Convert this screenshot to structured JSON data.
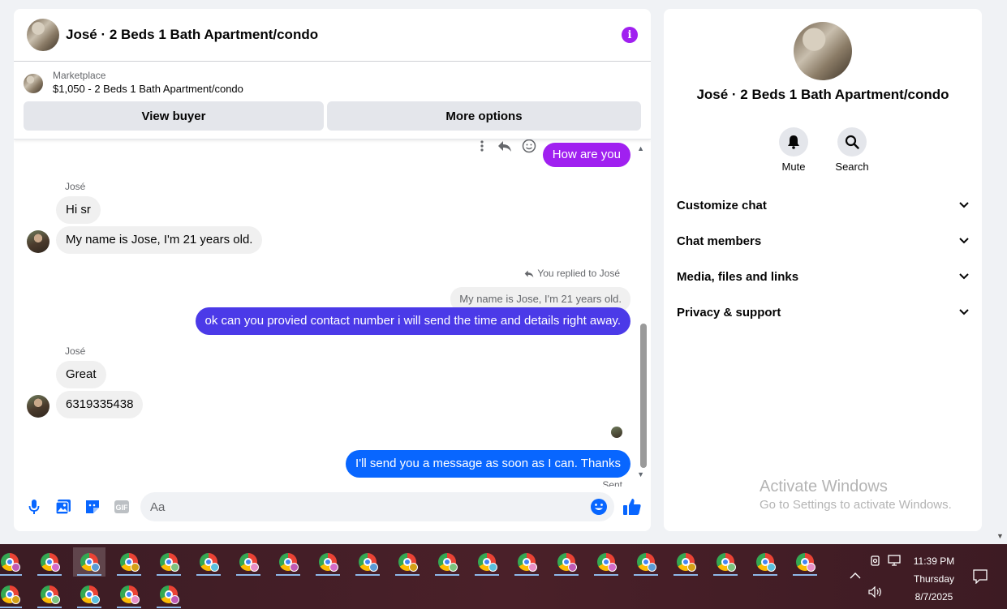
{
  "chat": {
    "title": "José · 2 Beds 1 Bath Apartment/condo",
    "marketplace_label": "Marketplace",
    "listing": "$1,050 - 2 Beds 1 Bath Apartment/condo",
    "view_buyer": "View buyer",
    "more_options": "More options",
    "input_placeholder": "Aa"
  },
  "messages": {
    "m1_out": "How are you",
    "sender1": "José",
    "m2_in": "Hi sr",
    "m3_in": "My name is Jose, I'm 21 years old.",
    "reply_meta": "You replied to José",
    "quoted": "My name is Jose, I'm 21 years old.",
    "m4_out": "ok can you provied contact number i will send the time and details right away.",
    "sender2": "José",
    "m5_in": "Great",
    "m6_in": "6319335438",
    "m7_out": "I'll send you a message as soon as I can. Thanks",
    "status": "Sent"
  },
  "details": {
    "title": "José · 2 Beds 1 Bath Apartment/condo",
    "mute": "Mute",
    "search": "Search",
    "sections": [
      "Customize chat",
      "Chat members",
      "Media, files and links",
      "Privacy & support"
    ]
  },
  "watermark": {
    "line1": "Activate Windows",
    "line2": "Go to Settings to activate Windows."
  },
  "taskbar": {
    "time": "11:39 PM",
    "day": "Thursday",
    "date": "8/7/2025",
    "badge_colors": [
      "#c05ab4",
      "#d46bc9",
      "#5b9bd5",
      "#d4a017",
      "#7cc47f",
      "#5bc0de",
      "#e88fc7"
    ]
  },
  "colors": {
    "accent_purple": "#a020f0",
    "bubble_indigo": "#4b3ae8",
    "bubble_blue": "#0866ff",
    "messenger_blue": "#0866ff"
  }
}
